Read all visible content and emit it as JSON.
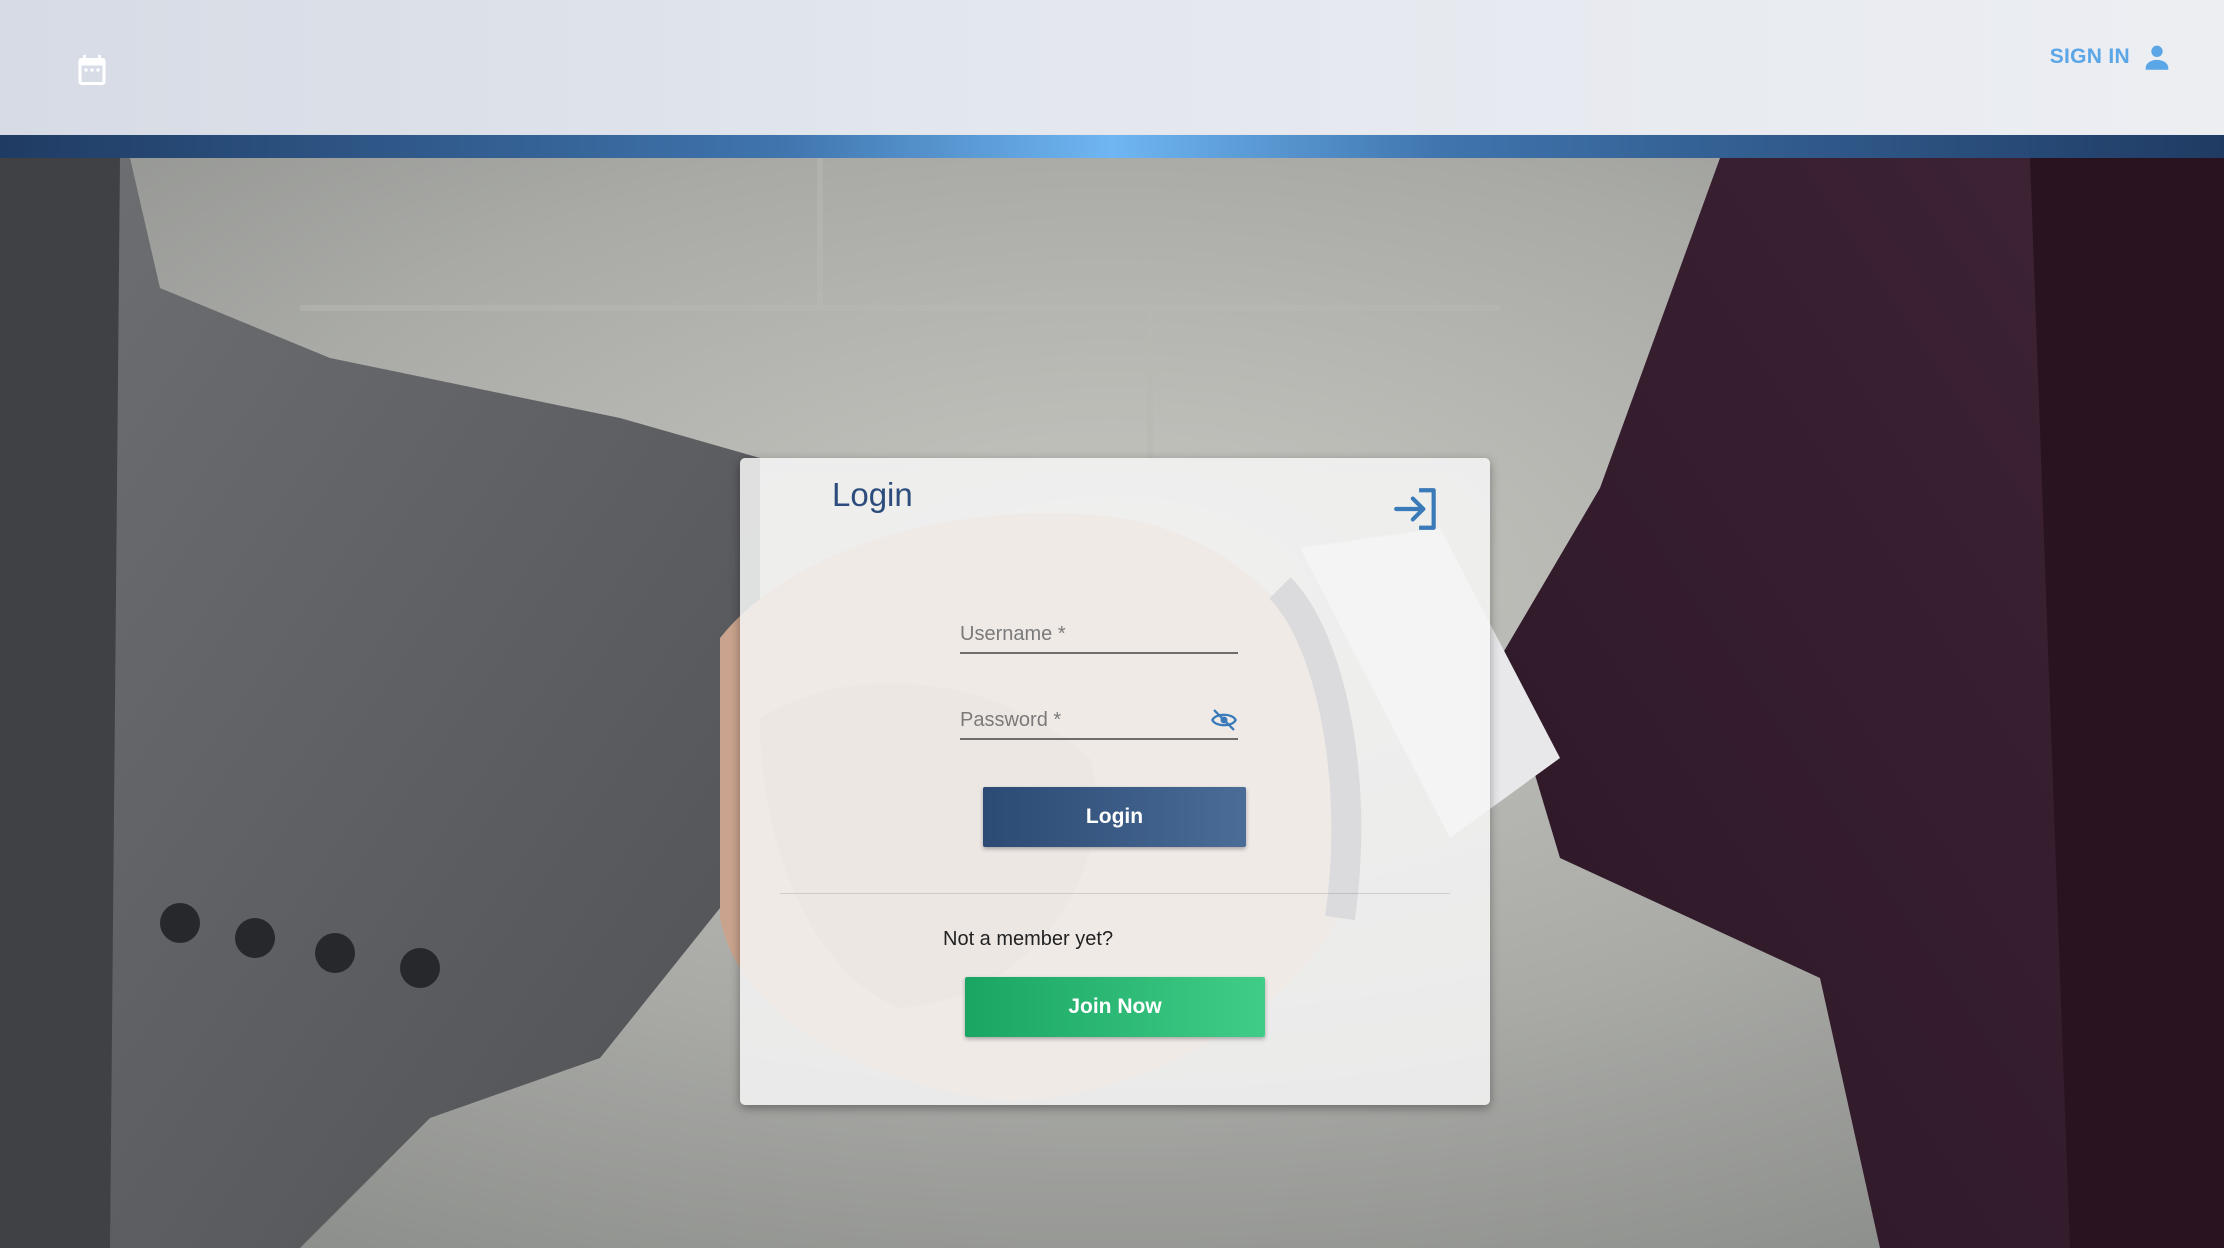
{
  "header": {
    "brand_icon": "calendar-icon",
    "signin_label": "SIGN IN",
    "signin_icon": "person-icon",
    "accent_color": "#5aa6e6"
  },
  "background": {
    "description_icon": "handshake-photo"
  },
  "login": {
    "title": "Login",
    "title_icon": "login-arrow-icon",
    "username_placeholder": "Username *",
    "password_placeholder": "Password *",
    "password_toggle_icon": "eye-off-icon",
    "login_button": "Login",
    "not_member_text": "Not a member yet?",
    "join_button": "Join Now",
    "colors": {
      "primary": "#2c4d7c",
      "join": "#1fb069"
    }
  }
}
